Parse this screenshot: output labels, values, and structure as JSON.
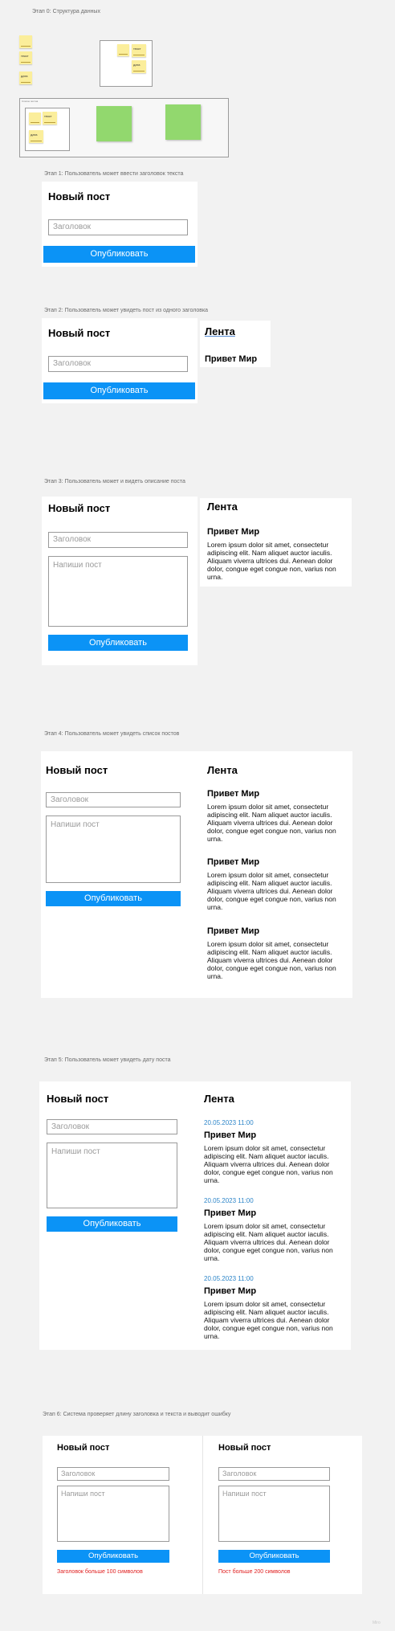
{
  "stages": {
    "s0": "Этап 0: Структура данных",
    "s1": "Этап 1: Пользователь может ввести заголовок текста",
    "s2": "Этап 2: Пользователь может увидеть пост из одного заголовка",
    "s3": "Этап 3: Пользователь может и видеть описание поста",
    "s4": "Этап 4: Пользователь может увидеть список постов",
    "s5": "Этап 5: Пользователь может увидеть дату поста",
    "s6": "Этап 6: Система проверяет длину заголовка и текста и выводит ошибку"
  },
  "diagram": {
    "note_title": "текст",
    "note_date": "дата",
    "frame_label": "Список постов"
  },
  "form": {
    "title": "Новый пост",
    "title_placeholder": "Заголовок",
    "body_placeholder": "Напиши пост",
    "publish": "Опубликовать"
  },
  "feed": {
    "title": "Лента",
    "post_title": "Привет Мир",
    "post_body": "Lorem ipsum dolor sit amet, consectetur adipiscing elit. Nam aliquet auctor iaculis. Aliquam viverra ultrices dui. Aenean dolor dolor, congue eget congue non, varius non urna.",
    "post_date": "20.05.2023 11:00"
  },
  "errors": {
    "title_error": "Заголовок больше 100 символов",
    "body_error": "Пост больше 200 символов"
  },
  "corner_mark": "Miro",
  "colors": {
    "button": "#0b93f6",
    "date": "#2e86c9",
    "error": "#e02020",
    "sticky": "#fbee9b",
    "sticky_green": "#92d86e",
    "background": "#f2f2f2"
  }
}
